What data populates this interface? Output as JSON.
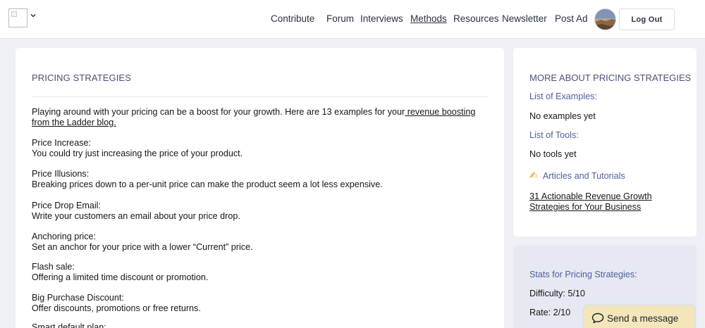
{
  "header": {
    "nav": [
      {
        "label": "Contribute",
        "active": false
      },
      {
        "label": "Forum",
        "active": false
      },
      {
        "label": "Interviews",
        "active": false
      },
      {
        "label": "Methods",
        "active": true
      },
      {
        "label": "Resources",
        "active": false
      },
      {
        "label": "Newsletter",
        "active": false
      },
      {
        "label": "Post Ad",
        "active": false
      }
    ],
    "logout_label": "Log Out",
    "avatar_icon": "user-avatar",
    "logo_icon": "broken-image-icon",
    "logo_menu_icon": "chevron-down-icon"
  },
  "main": {
    "title": "PRICING STRATEGIES",
    "intro_text": "Playing around with your pricing can be a boost for your growth. Here are 13 examples for your",
    "intro_link": " revenue boosting from the Ladder blog.",
    "strategies": [
      {
        "name": "Price Increase:",
        "desc": "You could try just increasing the price of your product."
      },
      {
        "name": "Price Illusions:",
        "desc": "Breaking prices down to a per-unit price can make the product seem a lot less expensive."
      },
      {
        "name": "Price Drop Email:",
        "desc": "Write your customers an email about your price drop."
      },
      {
        "name": "Anchoring price:",
        "desc": "Set an anchor for your price with a lower “Current” price."
      },
      {
        "name": "Flash sale:",
        "desc": "Offering a limited time discount or promotion."
      },
      {
        "name": "Big Purchase Discount:",
        "desc": "Offer discounts, promotions or free returns."
      },
      {
        "name": "Smart default plan:",
        "desc": ""
      }
    ]
  },
  "sidebar": {
    "title": "MORE ABOUT PRICING STRATEGIES",
    "examples_label": "List of Examples:",
    "examples_value": "No examples yet",
    "tools_label": "List of Tools:",
    "tools_value": "No tools yet",
    "articles_icon": "writing-hand-icon",
    "articles_label": "Articles and Tutorials",
    "article_link": "31 Actionable Revenue Growth Strategies for Your Business"
  },
  "stats": {
    "title": "Stats for Pricing Strategies:",
    "difficulty": "Difficulty: 5/10",
    "rate": "Rate: 2/10"
  },
  "chat": {
    "label": "Send a message",
    "icon": "chat-bubble-icon"
  },
  "colors": {
    "accent": "#4d5f9c",
    "page_bg": "#eef0f5",
    "chat_bg": "#f4e6b8"
  }
}
